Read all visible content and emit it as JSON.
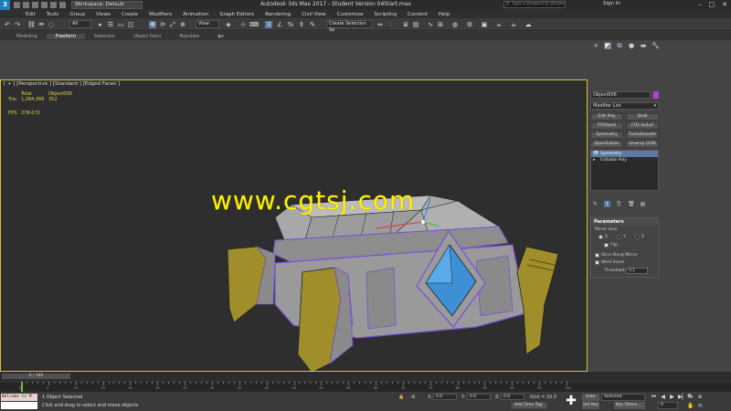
{
  "titlebar": {
    "logo": "3",
    "workspace": "Workspace: Default",
    "title": "Autodesk 3ds Max 2017 - Student Version   04Start.max",
    "search_placeholder": "Type a keyword or phrase",
    "signin": "Sign In"
  },
  "menubar": {
    "items": [
      "Edit",
      "Tools",
      "Group",
      "Views",
      "Create",
      "Modifiers",
      "Animation",
      "Graph Editors",
      "Rendering",
      "Civil View",
      "Customize",
      "Scripting",
      "Content",
      "Help"
    ]
  },
  "toolbar": {
    "filter": "All",
    "view": "View",
    "selection_set": "Create Selection Se"
  },
  "ribbon": {
    "tabs": [
      "Modeling",
      "Freeform",
      "Selection",
      "Object Paint",
      "Populate"
    ],
    "active": "Freeform"
  },
  "viewport": {
    "label": "[ + ] [Perspective ] [Standard ] [Edged Faces ]",
    "stats": {
      "total_label": "Total",
      "object_label": "Object006",
      "polys_label": "Tris:",
      "total_value": "1,264,366",
      "object_value": "352",
      "fps_label": "FPS:",
      "fps_value": "278.672"
    },
    "watermark": "www.cgtsj.com"
  },
  "command_panel": {
    "object_name": "Object006",
    "object_color": "#b23ed6",
    "modifier_list": "Modifier List",
    "buttons": [
      "Edit Poly",
      "Shell",
      "FFD(box)",
      "FFD 2x2x2",
      "Symmetry",
      "TurboSmooth",
      "OpenSubdiv",
      "Unwrap UVW"
    ],
    "stack": [
      "Symmetry",
      "Editable Poly"
    ],
    "parameters": {
      "header": "Parameters",
      "mirror_axis": "Mirror Axis:",
      "x": "X",
      "y": "Y",
      "z": "Z",
      "flip": "Flip",
      "slice": "Slice Along Mirror",
      "weld": "Weld Seam",
      "threshold_label": "Threshold:",
      "threshold_value": "0.1"
    }
  },
  "timeline": {
    "slider": "0 / 100",
    "ticks": [
      "0",
      "5",
      "10",
      "15",
      "20",
      "25",
      "30",
      "35",
      "40",
      "45",
      "50",
      "55",
      "60",
      "65",
      "70",
      "75",
      "80",
      "85",
      "90",
      "95",
      "100"
    ],
    "playhead_frame": 0
  },
  "status": {
    "maxscript": "Welcome to M",
    "selected": "1 Object Selected",
    "hint": "Click and drag to select and move objects",
    "x_label": "X:",
    "x_value": "0.0",
    "y_label": "Y:",
    "y_value": "0.0",
    "z_label": "Z:",
    "z_value": "0.0",
    "grid": "Grid = 10.0",
    "add_time_tag": "Add Time Tag",
    "auto_key": "Auto Key",
    "set_key": "Set Key",
    "selected_drop": "Selected",
    "key_filters": "Key Filters...",
    "frame": "0"
  }
}
